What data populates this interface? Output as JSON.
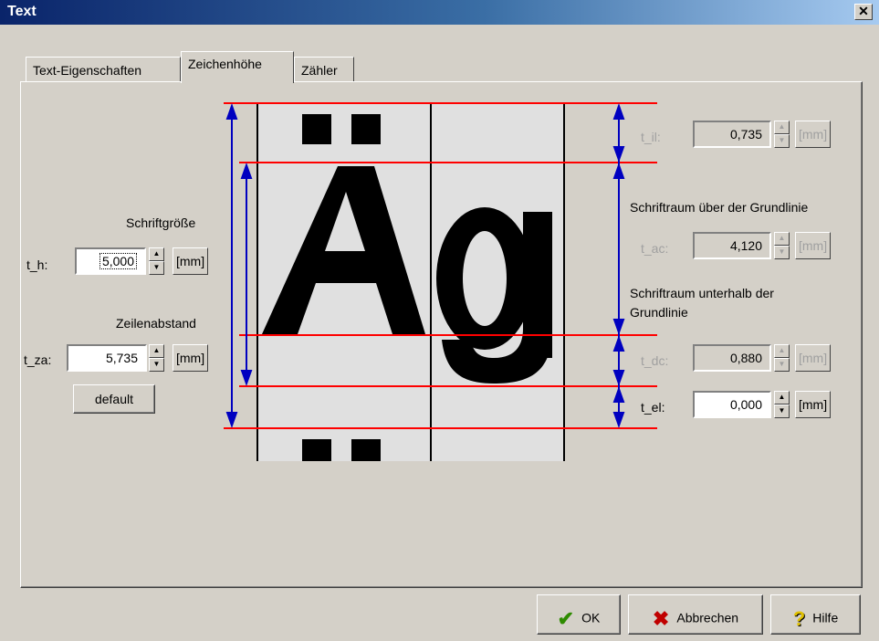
{
  "window": {
    "title": "Text",
    "close_glyph": "✕"
  },
  "tabs": [
    {
      "label": "Text-Eigenschaften",
      "active": false
    },
    {
      "label": "Zeichenhöhe",
      "active": true
    },
    {
      "label": "Zähler",
      "active": false
    }
  ],
  "left": {
    "schriftgroesse_label": "Schriftgröße",
    "th_label": "t_h:",
    "th_value": "5,000",
    "th_unit": "[mm]",
    "zeilenabstand_label": "Zeilenabstand",
    "tza_label": "t_za:",
    "tza_value": "5,735",
    "tza_unit": "[mm]",
    "default_label": "default"
  },
  "right": {
    "til_label": "t_il:",
    "til_value": "0,735",
    "til_unit": "[mm]",
    "ueber_label": "Schriftraum über der Grundlinie",
    "tac_label": "t_ac:",
    "tac_value": "4,120",
    "tac_unit": "[mm]",
    "unter_label_1": "Schriftraum unterhalb der",
    "unter_label_2": "Grundlinie",
    "tdc_label": "t_dc:",
    "tdc_value": "0,880",
    "tdc_unit": "[mm]",
    "tel_label": "t_el:",
    "tel_value": "0,000",
    "tel_unit": "[mm]"
  },
  "diagram": {
    "glyphs": "Ag",
    "umlaut_glyph": "Ä",
    "line_color": "#ff0000",
    "arrow_color": "#0000c0"
  },
  "footer": {
    "ok_label": "OK",
    "ok_icon": "check-icon",
    "cancel_label": "Abbrechen",
    "cancel_icon": "x-icon",
    "help_label": "Hilfe",
    "help_icon": "question-icon"
  }
}
